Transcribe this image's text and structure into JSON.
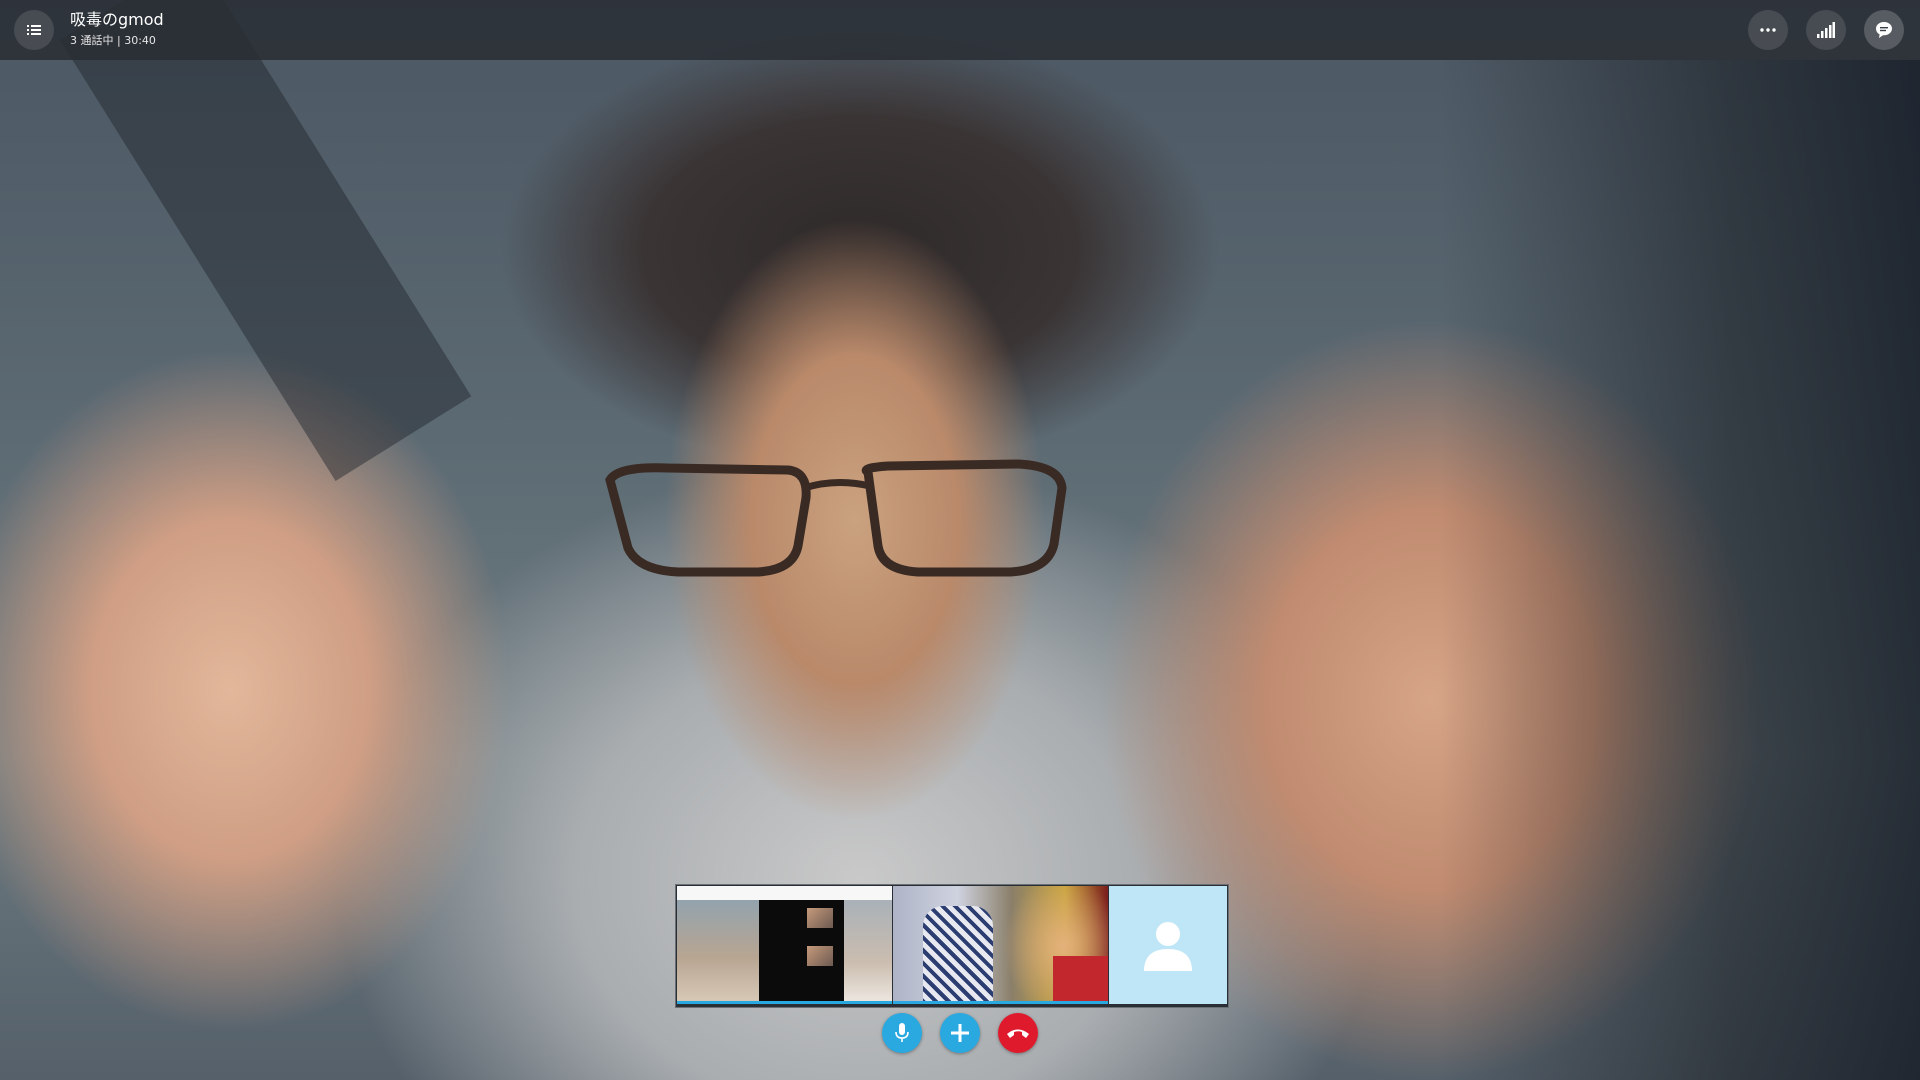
{
  "header": {
    "call_title": "吸毒のgmod",
    "call_status": "3 通話中 | 30:40"
  },
  "icons": {
    "menu": "list-icon",
    "more": "more-horizontal-icon",
    "signal": "signal-strength-icon",
    "chat": "chat-bubble-icon",
    "mic": "microphone-icon",
    "add": "plus-icon",
    "hangup": "hang-up-icon",
    "avatar": "person-icon"
  },
  "participants": [
    {
      "type": "video",
      "content": "screen share"
    },
    {
      "type": "video",
      "content": "camera"
    },
    {
      "type": "avatar",
      "content": "no video"
    }
  ],
  "colors": {
    "accent": "#2aa8e0",
    "hangup": "#e01a2d",
    "avatar_bg": "#bfe6f7",
    "topbar_bg": "#282c32"
  }
}
